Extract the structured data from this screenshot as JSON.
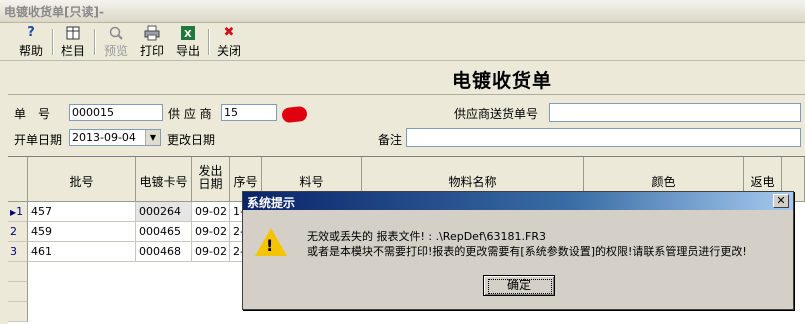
{
  "window": {
    "title": "电镀收货单[只读]-"
  },
  "toolbar": {
    "help": "帮助",
    "columns": "栏目",
    "preview": "预览",
    "print": "打印",
    "export": "导出",
    "close": "关闭"
  },
  "form": {
    "doc_title": "电镀收货单",
    "order_no_label": "单　号",
    "order_no": "000015",
    "supplier_label": "供 应 商",
    "supplier": "15",
    "supplier_delivery_label": "供应商送货单号",
    "supplier_delivery": "",
    "date_label": "开单日期",
    "date": "2013-09-04",
    "modify_date_label": "更改日期",
    "remark_label": "备注",
    "remark": ""
  },
  "grid": {
    "headers": [
      "批号",
      "电镀卡号",
      "发出日期",
      "序号",
      "料号",
      "物料名称",
      "颜色",
      "返电"
    ],
    "rows": [
      {
        "indicator": "1",
        "batch": "457",
        "card": "000264",
        "date": "09-02",
        "seq": "1-"
      },
      {
        "indicator": "2",
        "batch": "459",
        "card": "000465",
        "date": "09-02",
        "seq": "2-"
      },
      {
        "indicator": "3",
        "batch": "461",
        "card": "000468",
        "date": "09-02",
        "seq": "2-"
      }
    ]
  },
  "dialog": {
    "title": "系统提示",
    "line1": "无效或丢失的 报表文件! : .\\RepDef\\63181.FR3",
    "line2": "或者是本模块不需要打印!报表的更改需要有[系统参数设置]的权限!请联系管理员进行更改!",
    "ok": "确定"
  }
}
